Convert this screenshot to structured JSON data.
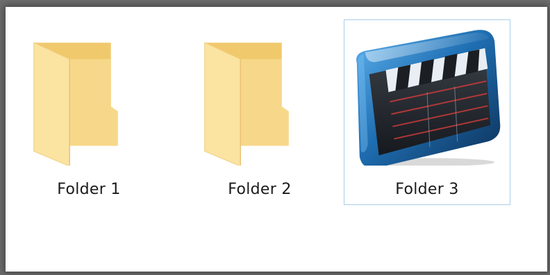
{
  "folders": [
    {
      "name": "Folder 1",
      "icon": "folder-icon",
      "selected": false
    },
    {
      "name": "Folder 2",
      "icon": "folder-icon",
      "selected": false
    },
    {
      "name": "Folder 3",
      "icon": "clapperboard-folder-icon",
      "selected": true
    }
  ],
  "colors": {
    "folder_back": "#f3cf78",
    "folder_front": "#fbe3a2",
    "selection_border": "#a9cde8",
    "case_blue": "#2b7fc4"
  }
}
